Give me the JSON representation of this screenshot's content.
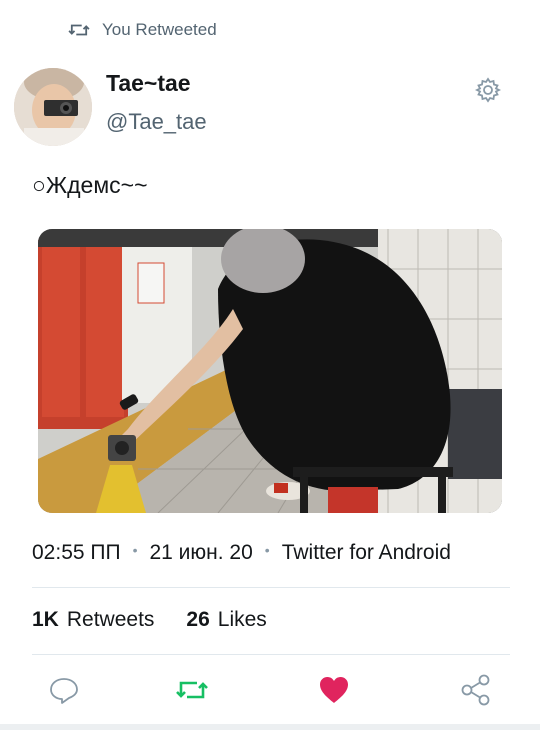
{
  "retweet_context": {
    "label": "You Retweeted",
    "icon": "retweet-icon"
  },
  "author": {
    "display_name": "Tae~tae",
    "handle": "@Tae_tae"
  },
  "tweet": {
    "text": "○Ждемс~~"
  },
  "meta": {
    "time": "02:55 ПП",
    "date": "21 июн. 20",
    "source": "Twitter for Android"
  },
  "stats": {
    "retweets_count": "1K",
    "retweets_label": "Retweets",
    "likes_count": "26",
    "likes_label": "Likes"
  },
  "actions": {
    "reply_icon": "reply-icon",
    "retweet_icon": "retweet-icon",
    "like_icon": "heart-icon",
    "share_icon": "share-icon"
  },
  "colors": {
    "retweet_active": "#17bf63",
    "like_active": "#e0245e",
    "secondary_text": "#536471",
    "divider": "#e1e8ed"
  }
}
